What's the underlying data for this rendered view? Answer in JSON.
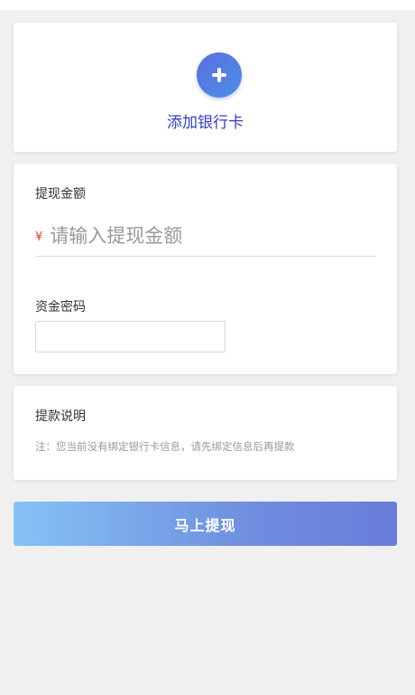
{
  "bank_card": {
    "add_label": "添加银行卡",
    "icon": "plus-circle-icon"
  },
  "withdraw": {
    "amount_title": "提现金额",
    "currency_symbol": "¥",
    "amount_placeholder": "请输入提现金额",
    "amount_value": "",
    "password_title": "资金密码",
    "password_value": ""
  },
  "notes": {
    "title": "提款说明",
    "text": "注：您当前没有绑定银行卡信息，请先绑定信息后再提款"
  },
  "submit": {
    "label": "马上提现"
  },
  "colors": {
    "accent": "#3340c8",
    "currency": "#e53935",
    "button_start": "#86c2f6",
    "button_end": "#6a7cd9",
    "background": "#f0f0f0"
  }
}
